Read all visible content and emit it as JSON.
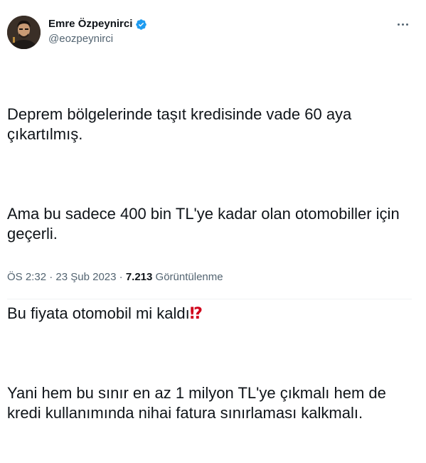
{
  "author": {
    "name": "Emre Özpeynirci",
    "handle": "@eozpeynirci",
    "verified_color": "#1d9bf0"
  },
  "tweet": {
    "paragraphs": [
      "Deprem bölgelerinde taşıt kredisinde vade 60 aya çıkartılmış.",
      "Ama bu sadece 400 bin TL'ye kadar olan otomobiller için geçerli.",
      "Bu fiyata otomobil mi kaldı",
      "Yani hem bu sınır en az 1 milyon TL'ye çıkmalı hem de kredi kullanımında nihai fatura sınırlaması kalkmalı."
    ],
    "emoji": "⁉"
  },
  "meta": {
    "time": "ÖS 2:32",
    "separator": "·",
    "date": "23 Şub 2023",
    "views_count": "7.213",
    "views_label": "Görüntülenme"
  },
  "icons": {
    "verified": "verified-badge-icon",
    "more": "more-options-icon",
    "emoji": "exclamation-question-mark-icon"
  }
}
